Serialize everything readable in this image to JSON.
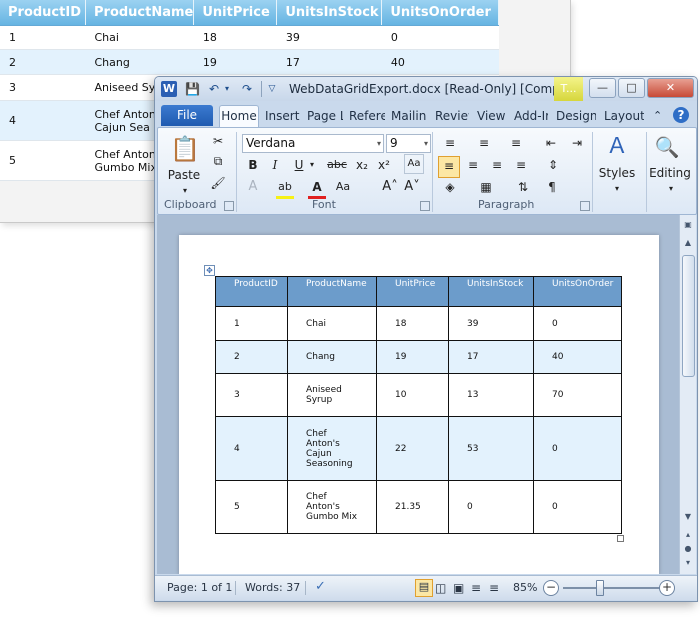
{
  "grid": {
    "columns": [
      "ProductID",
      "ProductName",
      "UnitPrice",
      "UnitsInStock",
      "UnitsOnOrder"
    ],
    "rows": [
      {
        "id": "1",
        "name_l1": "Chai",
        "name_l2": "",
        "price": "18",
        "stock": "39",
        "order": "0"
      },
      {
        "id": "2",
        "name_l1": "Chang",
        "name_l2": "",
        "price": "19",
        "stock": "17",
        "order": "40"
      },
      {
        "id": "3",
        "name_l1": "Aniseed Sy",
        "name_l2": "",
        "price": "",
        "stock": "",
        "order": ""
      },
      {
        "id": "4",
        "name_l1": "Chef Anton",
        "name_l2": "Cajun Sea",
        "price": "",
        "stock": "",
        "order": ""
      },
      {
        "id": "5",
        "name_l1": "Chef Anton",
        "name_l2": "Gumbo Mix",
        "price": "",
        "stock": "",
        "order": ""
      }
    ]
  },
  "window": {
    "title": "WebDataGridExport.docx [Read-Only] [Comp...",
    "contextual_tab": "T...",
    "logo": "W"
  },
  "tabs": {
    "file": "File",
    "items": [
      "Home",
      "Insert",
      "Page L",
      "Refere",
      "Mailin",
      "Review",
      "View",
      "Add-Ir",
      "Design",
      "Layout"
    ]
  },
  "ribbon": {
    "paste": "Paste",
    "font_name": "Verdana",
    "font_size": "9",
    "bold": "B",
    "italic": "I",
    "underline": "U",
    "strike": "abc",
    "subscript": "x₂",
    "superscript": "x²",
    "styles": "Styles",
    "editing": "Editing",
    "groups": {
      "clipboard": "Clipboard",
      "font": "Font",
      "paragraph": "Paragraph"
    }
  },
  "doc_table": {
    "columns": [
      "ProductID",
      "ProductName",
      "UnitPrice",
      "UnitsInStock",
      "UnitsOnOrder"
    ],
    "rows": [
      {
        "id": "1",
        "name": [
          "Chai"
        ],
        "price": "18",
        "stock": "39",
        "order": "0"
      },
      {
        "id": "2",
        "name": [
          "Chang"
        ],
        "price": "19",
        "stock": "17",
        "order": "40"
      },
      {
        "id": "3",
        "name": [
          "Aniseed",
          "Syrup"
        ],
        "price": "10",
        "stock": "13",
        "order": "70"
      },
      {
        "id": "4",
        "name": [
          "Chef",
          "Anton's",
          "Cajun",
          "Seasoning"
        ],
        "price": "22",
        "stock": "53",
        "order": "0"
      },
      {
        "id": "5",
        "name": [
          "Chef",
          "Anton's",
          "Gumbo Mix"
        ],
        "price": "21.35",
        "stock": "0",
        "order": "0"
      }
    ]
  },
  "status": {
    "page": "Page: 1 of 1",
    "words": "Words: 37",
    "zoom": "85%",
    "zoom_value": 85
  }
}
